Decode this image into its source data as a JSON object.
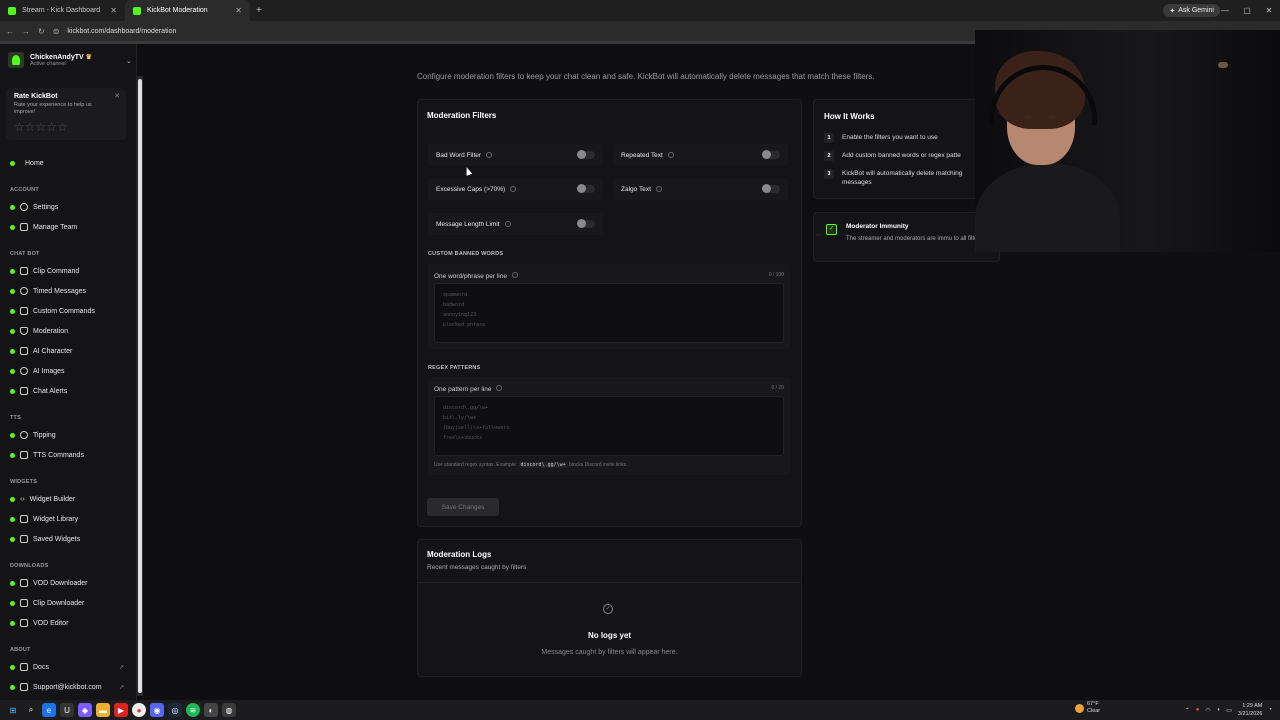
{
  "browser": {
    "tabs": [
      {
        "title": "Stream - Kick Dashboard",
        "active": false
      },
      {
        "title": "KickBot Moderation",
        "active": true
      }
    ],
    "url": "kickbot.com/dashboard/moderation",
    "ask_gemini": "Ask Gemini"
  },
  "channel": {
    "name": "ChickenAndyTV",
    "status": "Active channel"
  },
  "rate": {
    "title": "Rate KickBot",
    "subtitle": "Rate your experience to help us improve!",
    "stars": "☆☆☆☆☆"
  },
  "nav": {
    "home": "Home",
    "account_section": "ACCOUNT",
    "settings": "Settings",
    "manage_team": "Manage Team",
    "chatbot_section": "CHAT BOT",
    "clip_command": "Clip Command",
    "timed_messages": "Timed Messages",
    "custom_commands": "Custom Commands",
    "moderation": "Moderation",
    "ai_character": "AI Character",
    "ai_images": "AI Images",
    "chat_alerts": "Chat Alerts",
    "tts_section": "TTS",
    "tipping": "Tipping",
    "tts_commands": "TTS Commands",
    "widgets_section": "WIDGETS",
    "widget_builder": "Widget Builder",
    "widget_library": "Widget Library",
    "saved_widgets": "Saved Widgets",
    "downloads_section": "DOWNLOADS",
    "vod_downloader": "VOD Downloader",
    "clip_downloader": "Clip Downloader",
    "vod_editor": "VOD Editor",
    "about_section": "ABOUT",
    "docs": "Docs",
    "support": "Support@kickbot.com"
  },
  "main": {
    "intro": "Configure moderation filters to keep your chat clean and safe. KickBot will automatically delete messages that match these filters.",
    "filters_title": "Moderation Filters",
    "filters": {
      "bad_word": "Bad Word Filter",
      "repeated_text": "Repeated Text",
      "excessive_caps": "Excessive Caps (>70%)",
      "zalgo": "Zalgo Text",
      "length_limit": "Message Length Limit"
    },
    "banned_words": {
      "section": "CUSTOM BANNED WORDS",
      "label": "One word/phrase per line",
      "count": "0 / 100",
      "placeholder": "spamword\nbadword\nannoying123\nblocked phrase"
    },
    "regex": {
      "section": "REGEX PATTERNS",
      "label": "One pattern per line",
      "count": "0 / 20",
      "placeholder": "discord\\.gg/\\w+\nbit\\.ly/\\w+\n(buy|sell)\\s+followers\nfree\\s+vbucks",
      "hint_pre": "Use standard regex syntax. Example:",
      "hint_code": "discord\\.gg/\\w+",
      "hint_post": "blocks Discord invite links."
    },
    "save": "Save Changes",
    "logs": {
      "title": "Moderation Logs",
      "subtitle": "Recent messages caught by filters",
      "empty_title": "No logs yet",
      "empty_sub": "Messages caught by filters will appear here."
    }
  },
  "how": {
    "title": "How It Works",
    "steps": [
      {
        "n": "1",
        "text": "Enable the filters you want to use"
      },
      {
        "n": "2",
        "text": "Add custom banned words or regex patte"
      },
      {
        "n": "3",
        "text": "KickBot will automatically delete matching messages"
      }
    ],
    "immunity_title": "Moderator Immunity",
    "immunity_text": "The streamer and moderators are immu to all filters."
  },
  "taskbar": {
    "weather_temp": "67°F",
    "weather_desc": "Clear",
    "time": "1:29 AM",
    "date": "3/21/2026"
  }
}
